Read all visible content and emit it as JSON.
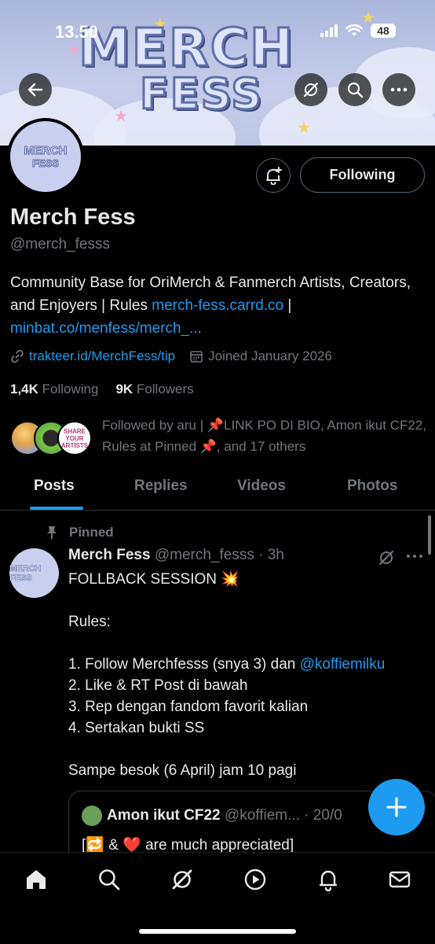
{
  "status_bar": {
    "time": "13.50",
    "battery": "48"
  },
  "banner": {
    "title_line1": "MERCH",
    "title_line2": "FESS"
  },
  "profile": {
    "name": "Merch Fess",
    "handle": "@merch_fesss",
    "avatar_line1": "MERCH",
    "avatar_line2": "FESS",
    "bio_prefix": "Community Base for OriMerch & Fanmerch Artists, Creators, and Enjoyers | Rules ",
    "bio_link1": "merch-fess.carrd.co",
    "bio_sep": " | ",
    "bio_link2": "minbat.co/menfess/merch_...",
    "website": "trakteer.id/MerchFess/tip",
    "joined": "Joined January 2026",
    "following_count": "1,4K",
    "following_label": "Following",
    "followers_count": "9K",
    "followers_label": "Followers",
    "followed_by": "Followed by aru | 📌LINK PO DI BIO, Amon ikut CF22, Rules at Pinned 📌, and 17 others",
    "mini_avatar3_text": "SHARE YOUR ARTISTS"
  },
  "buttons": {
    "following": "Following"
  },
  "tabs": [
    {
      "label": "Posts"
    },
    {
      "label": "Replies"
    },
    {
      "label": "Videos"
    },
    {
      "label": "Photos"
    }
  ],
  "post": {
    "pinned_label": "Pinned",
    "author_name": "Merch Fess",
    "author_meta": "@merch_fesss · 3h",
    "lines": [
      "FOLLBACK SESSION 💥",
      "",
      "Rules:",
      "",
      "1. Follow Merchfesss (snya 3) dan ",
      "2. Like & RT Post di bawah",
      "3. Rep dengan fandom favorit kalian",
      "4. Sertakan bukti SS",
      "",
      "Sampe besok (6 April) jam 10 pagi"
    ],
    "mention": "@koffiemilku",
    "avatar_text": "MERCH FESS"
  },
  "quote": {
    "author_name": "Amon ikut CF22",
    "author_meta": "@koffiem... · 20/0",
    "text": "[🔁 & ❤️ are much appreciated]"
  },
  "icons": {
    "back": "back-arrow-icon",
    "grok": "grok-icon",
    "search": "search-icon",
    "more": "more-icon",
    "notif": "notification-bell-icon",
    "link": "link-icon",
    "calendar": "calendar-icon",
    "pin": "pin-icon",
    "compose": "plus-icon"
  },
  "colors": {
    "accent": "#1d9bf0",
    "muted": "#71767b",
    "text": "#e7e9ea",
    "background": "#000000"
  }
}
